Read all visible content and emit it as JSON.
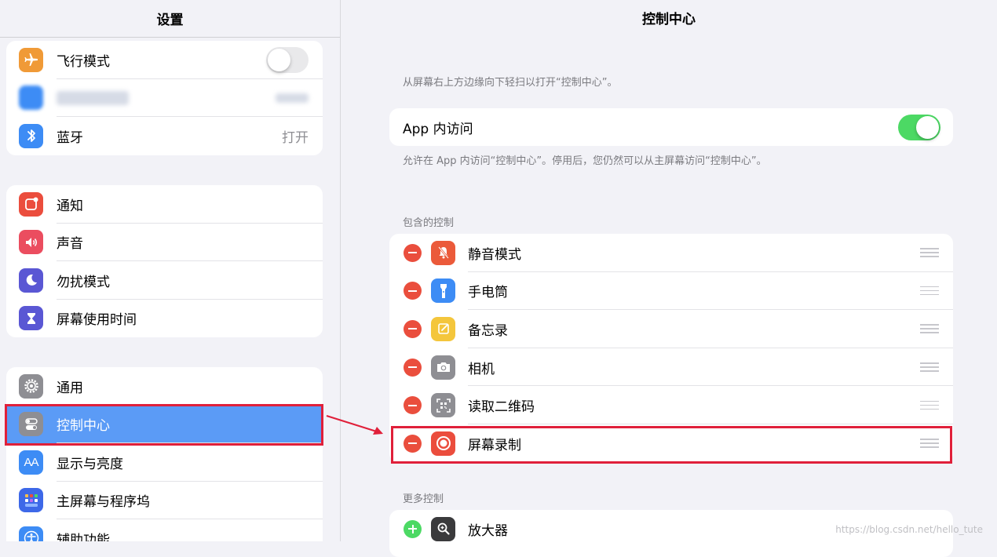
{
  "sidebar": {
    "title": "设置",
    "groups": [
      {
        "items": [
          {
            "label": "飞行模式",
            "icon": "airplane-icon",
            "color": "#f09a37",
            "toggle": false
          },
          {
            "label": "",
            "icon": "wifi-icon",
            "color": "#3d8cf5",
            "blurred": true
          },
          {
            "label": "蓝牙",
            "icon": "bluetooth-icon",
            "color": "#3d8cf5",
            "value": "打开"
          }
        ]
      },
      {
        "items": [
          {
            "label": "通知",
            "icon": "notification-icon",
            "color": "#eb4d3d"
          },
          {
            "label": "声音",
            "icon": "speaker-icon",
            "color": "#eb4d5f"
          },
          {
            "label": "勿扰模式",
            "icon": "moon-icon",
            "color": "#5a57d4"
          },
          {
            "label": "屏幕使用时间",
            "icon": "hourglass-icon",
            "color": "#5a57d4"
          }
        ]
      },
      {
        "items": [
          {
            "label": "通用",
            "icon": "gear-icon",
            "color": "#8e8e93"
          },
          {
            "label": "控制中心",
            "icon": "switches-icon",
            "color": "#8e8e93",
            "selected": true
          },
          {
            "label": "显示与亮度",
            "icon": "text-size-icon",
            "color": "#3d8cf5"
          },
          {
            "label": "主屏幕与程序坞",
            "icon": "home-grid-icon",
            "color": "#3d68e8"
          },
          {
            "label": "辅助功能",
            "icon": "accessibility-icon",
            "color": "#3d8cf5"
          }
        ]
      }
    ]
  },
  "main": {
    "title": "控制中心",
    "swipe_note": "从屏幕右上方边缘向下轻扫以打开“控制中心”。",
    "access": {
      "label": "App 内访问",
      "toggle": true
    },
    "access_note": "允许在 App 内访问“控制中心”。停用后，您仍然可以从主屏幕访问“控制中心”。",
    "included_header": "包含的控制",
    "included": [
      {
        "label": "静音模式",
        "icon": "bell-slash-icon",
        "color": "#eb5a3a"
      },
      {
        "label": "手电筒",
        "icon": "flashlight-icon",
        "color": "#3d8cf5"
      },
      {
        "label": "备忘录",
        "icon": "notes-icon",
        "color": "#f4c63c"
      },
      {
        "label": "相机",
        "icon": "camera-icon",
        "color": "#8e8e93"
      },
      {
        "label": "读取二维码",
        "icon": "qr-code-icon",
        "color": "#8e8e93"
      },
      {
        "label": "屏幕录制",
        "icon": "screen-record-icon",
        "color": "#eb4d3d"
      }
    ],
    "more_header": "更多控制",
    "more": [
      {
        "label": "放大器",
        "icon": "magnifier-icon",
        "color": "#3a3a3c"
      }
    ]
  },
  "annotation_color": "#e0203a",
  "watermark": "https://blog.csdn.net/hello_tute"
}
